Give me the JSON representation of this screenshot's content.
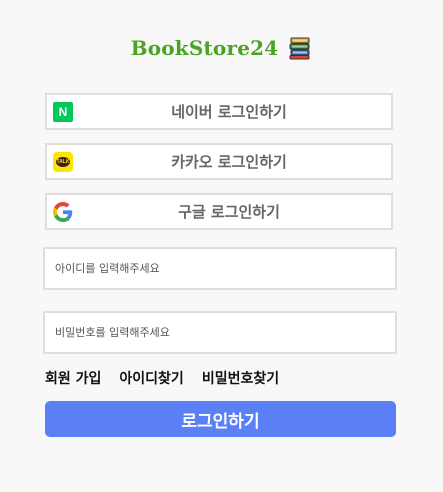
{
  "brand": {
    "title": "BookStore24",
    "icon": "books-icon"
  },
  "social_logins": {
    "naver": {
      "label": "네이버 로그인하기",
      "icon": "naver-icon",
      "icon_text": "N",
      "color": "#03c75a"
    },
    "kakao": {
      "label": "카카오 로그인하기",
      "icon": "kakao-icon",
      "icon_text": "TALK",
      "color": "#fee500"
    },
    "google": {
      "label": "구글 로그인하기",
      "icon": "google-icon"
    }
  },
  "form": {
    "userid_placeholder": "아이디를 입력해주세요",
    "password_placeholder": "비밀번호를 입력해주세요",
    "userid_value": "",
    "password_value": ""
  },
  "links": {
    "signup": "회원 가입",
    "find_id": "아이디찾기",
    "find_password": "비밀번호찾기"
  },
  "login_button": {
    "label": "로그인하기",
    "color": "#5b7ff5"
  },
  "colors": {
    "brand_green": "#4aa321",
    "border": "#dedede",
    "background": "#f8f8f8"
  }
}
